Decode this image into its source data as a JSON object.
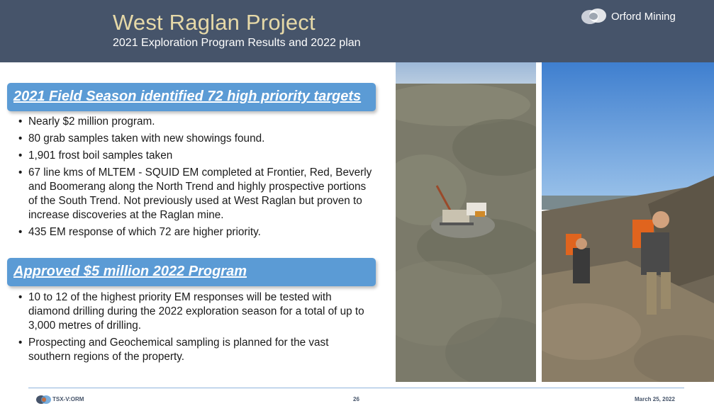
{
  "header": {
    "title": "West Raglan Project",
    "subtitle": "2021 Exploration Program Results and 2022 plan",
    "logo_text": "Orford Mining"
  },
  "section1": {
    "heading": "2021 Field Season identified 72 high priority targets",
    "bullets": [
      "Nearly $2 million program.",
      "80 grab samples taken with new showings found.",
      "1,901 frost boil samples taken",
      "67 line kms of MLTEM - SQUID EM completed at Frontier, Red, Beverly and Boomerang along the North Trend and highly prospective portions of the South Trend.  Not previously used at West Raglan but proven to increase discoveries at the Raglan mine.",
      "435 EM response of which 72 are higher priority."
    ]
  },
  "section2": {
    "heading": "Approved $5 million 2022 Program",
    "bullets": [
      "10 to 12 of the highest priority EM responses will be tested with diamond drilling during the 2022 exploration season for a total of up to 3,000 metres of drilling.",
      "Prospecting and Geochemical sampling is planned for the vast southern regions of the property."
    ]
  },
  "footer": {
    "ticker": "TSX-V:ORM",
    "page_number": "26",
    "date": "March 25, 2022"
  },
  "colors": {
    "header_bg": "#46546a",
    "title": "#e6d9a8",
    "banner": "#5b9bd5"
  }
}
